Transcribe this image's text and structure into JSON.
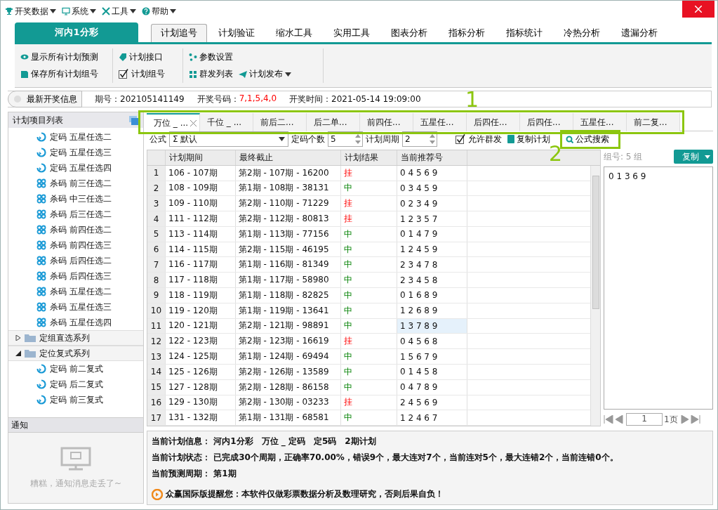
{
  "menu": [
    {
      "label": "开奖数据"
    },
    {
      "label": "系统"
    },
    {
      "label": "工具"
    },
    {
      "label": "帮助"
    }
  ],
  "lottery_tab": "河内1分彩",
  "tabs": [
    {
      "label": "计划追号",
      "selected": true
    },
    {
      "label": "计划验证",
      "selected": false
    },
    {
      "label": "缩水工具",
      "selected": false
    },
    {
      "label": "实用工具",
      "selected": false
    },
    {
      "label": "图表分析",
      "selected": false
    },
    {
      "label": "指标分析",
      "selected": false
    },
    {
      "label": "指标统计",
      "selected": false
    },
    {
      "label": "冷热分析",
      "selected": false
    },
    {
      "label": "遗漏分析",
      "selected": false
    }
  ],
  "ribbon": [
    [
      {
        "label": "显示所有计划预测"
      },
      {
        "label": "保存所有计划组号"
      }
    ],
    [
      {
        "label": "计划接口"
      },
      {
        "label": "计划组号",
        "kind": "checkbox",
        "checked": true
      }
    ],
    [
      {
        "label": "参数设置"
      },
      {
        "label": "群发列表"
      },
      {
        "label": "计划发布",
        "dropdown": true
      }
    ]
  ],
  "draw_info": {
    "button": "最新开奖信息",
    "issue_label": "期号：",
    "issue": "202105141149",
    "numbers_label": "开奖号码：",
    "numbers": "7,1,5,4,0",
    "time_label": "开奖时间：",
    "time": "2021-05-14 19:09:00"
  },
  "sidebar": {
    "title": "计划项目列表",
    "items": [
      {
        "kind": "ding",
        "label": "定码 五星任选二"
      },
      {
        "kind": "ding",
        "label": "定码 五星任选三"
      },
      {
        "kind": "ding",
        "label": "定码 五星任选四"
      },
      {
        "kind": "sha",
        "label": "杀码 前三任选二"
      },
      {
        "kind": "sha",
        "label": "杀码 中三任选二"
      },
      {
        "kind": "sha",
        "label": "杀码 后三任选二"
      },
      {
        "kind": "sha",
        "label": "杀码 前四任选二"
      },
      {
        "kind": "sha",
        "label": "杀码 前四任选三"
      },
      {
        "kind": "sha",
        "label": "杀码 后四任选二"
      },
      {
        "kind": "sha",
        "label": "杀码 后四任选三"
      },
      {
        "kind": "sha",
        "label": "杀码 五星任选二"
      },
      {
        "kind": "sha",
        "label": "杀码 五星任选三"
      },
      {
        "kind": "sha",
        "label": "杀码 五星任选四"
      }
    ],
    "groups": [
      {
        "label": "定组直选系列",
        "expanded": false
      },
      {
        "label": "定位复式系列",
        "expanded": true,
        "children": [
          {
            "kind": "ding",
            "label": "定码 前二复式"
          },
          {
            "kind": "ding",
            "label": "定码 后二复式"
          },
          {
            "kind": "ding",
            "label": "定码 前三复式"
          }
        ]
      }
    ]
  },
  "notice": {
    "title": "通知",
    "empty_text": "糟糕，通知消息走丢了~"
  },
  "plan_tabs": [
    {
      "label": "万位 _ ...",
      "selected": true
    },
    {
      "label": "千位 _ ...",
      "selected": false
    },
    {
      "label": "前后二...",
      "selected": false
    },
    {
      "label": "后二单...",
      "selected": false
    },
    {
      "label": "前四任...",
      "selected": false
    },
    {
      "label": "五星任...",
      "selected": false
    },
    {
      "label": "后四任...",
      "selected": false
    },
    {
      "label": "后四任...",
      "selected": false
    },
    {
      "label": "五星任...",
      "selected": false
    },
    {
      "label": "前二复...",
      "selected": false
    }
  ],
  "toolbar": {
    "formula_label": "公式",
    "formula_symbol": "Σ",
    "formula_value": "默认",
    "count_label": "定码个数",
    "count": "5",
    "period_label": "计划周期",
    "period": "2",
    "allow_group": {
      "label": "允许群发",
      "checked": true
    },
    "copy_plan": "复制计划",
    "search": "公式搜索"
  },
  "table": {
    "columns": [
      "计划期间",
      "最终截止",
      "计划结果",
      "当前推荐号"
    ],
    "rows": [
      {
        "n": "1",
        "period": "106 - 107期",
        "deadline": "第2期 - 107期 - 16200",
        "result": "挂",
        "hit": false,
        "numbers": "0 4 5 6 9",
        "selected": false
      },
      {
        "n": "2",
        "period": "108 - 109期",
        "deadline": "第1期 - 108期 - 38131",
        "result": "中",
        "hit": true,
        "numbers": "0 3 4 5 9",
        "selected": false
      },
      {
        "n": "3",
        "period": "109 - 110期",
        "deadline": "第2期 - 110期 - 71229",
        "result": "挂",
        "hit": false,
        "numbers": "0 2 3 4 9",
        "selected": false
      },
      {
        "n": "4",
        "period": "111 - 112期",
        "deadline": "第2期 - 112期 - 80813",
        "result": "挂",
        "hit": false,
        "numbers": "1 2 3 5 7",
        "selected": false
      },
      {
        "n": "5",
        "period": "113 - 114期",
        "deadline": "第1期 - 113期 - 77156",
        "result": "中",
        "hit": true,
        "numbers": "0 1 4 7 9",
        "selected": false
      },
      {
        "n": "6",
        "period": "114 - 115期",
        "deadline": "第2期 - 115期 - 46195",
        "result": "中",
        "hit": true,
        "numbers": "1 2 4 5 9",
        "selected": false
      },
      {
        "n": "7",
        "period": "116 - 117期",
        "deadline": "第1期 - 116期 - 81349",
        "result": "中",
        "hit": true,
        "numbers": "2 3 4 7 8",
        "selected": false
      },
      {
        "n": "8",
        "period": "117 - 118期",
        "deadline": "第1期 - 117期 - 58980",
        "result": "中",
        "hit": true,
        "numbers": "2 3 4 5 8",
        "selected": false
      },
      {
        "n": "9",
        "period": "118 - 119期",
        "deadline": "第1期 - 118期 - 82825",
        "result": "中",
        "hit": true,
        "numbers": "0 1 6 8 9",
        "selected": false
      },
      {
        "n": "10",
        "period": "119 - 120期",
        "deadline": "第1期 - 119期 - 13641",
        "result": "中",
        "hit": true,
        "numbers": "1 2 6 8 9",
        "selected": false
      },
      {
        "n": "11",
        "period": "120 - 121期",
        "deadline": "第2期 - 121期 - 98891",
        "result": "中",
        "hit": true,
        "numbers": "1 3 7 8 9",
        "selected": true
      },
      {
        "n": "12",
        "period": "122 - 123期",
        "deadline": "第2期 - 123期 - 16619",
        "result": "挂",
        "hit": false,
        "numbers": "0 4 5 6 8",
        "selected": false
      },
      {
        "n": "13",
        "period": "124 - 125期",
        "deadline": "第1期 - 124期 - 69494",
        "result": "中",
        "hit": true,
        "numbers": "1 5 6 7 9",
        "selected": false
      },
      {
        "n": "14",
        "period": "125 - 126期",
        "deadline": "第2期 - 126期 - 13589",
        "result": "中",
        "hit": true,
        "numbers": "0 1 4 5 8",
        "selected": false
      },
      {
        "n": "15",
        "period": "127 - 128期",
        "deadline": "第2期 - 128期 - 86158",
        "result": "中",
        "hit": true,
        "numbers": "0 4 7 8 9",
        "selected": false
      },
      {
        "n": "16",
        "period": "129 - 130期",
        "deadline": "第2期 - 130期 - 03233",
        "result": "挂",
        "hit": false,
        "numbers": "2 4 5 6 9",
        "selected": false
      },
      {
        "n": "17",
        "period": "131 - 132期",
        "deadline": "第1期 - 131期 - 68581",
        "result": "中",
        "hit": true,
        "numbers": "1 2 4 6 7",
        "selected": false
      }
    ]
  },
  "group_panel": {
    "label": "组号: 5 组",
    "copy_button": "复制",
    "text": "0 1 3 6 9",
    "page": "1",
    "page_total": "1页"
  },
  "summary": [
    {
      "label": "当前计划信息：",
      "value": "河内1分彩　万位 _ 定码　定5码　2期计划"
    },
    {
      "label": "当前计划状态：",
      "value": "已完成30个周期，正确率70.00%，错误9个，最大连对7个，当前连对5个，最大连错2个，当前连错0个。"
    },
    {
      "label": "当前预测周期：",
      "value": "第1期"
    }
  ],
  "notice_line": "众赢国际版提醒您：本软件仅做彩票数据分析及数理研究，否则后果自负！",
  "annotations": [
    {
      "label": "1"
    },
    {
      "label": "2"
    }
  ]
}
